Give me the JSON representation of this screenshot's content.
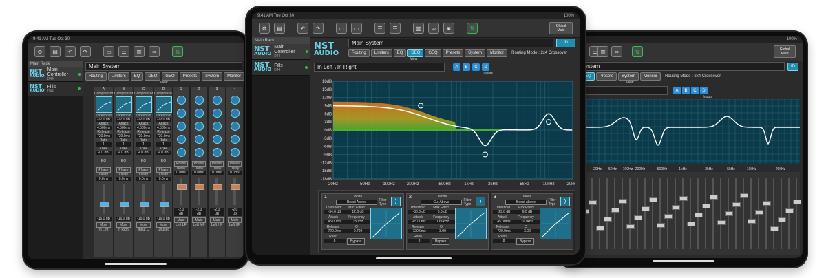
{
  "status": {
    "time": "9:41 AM",
    "date": "Tue Oct 30",
    "battery": "100%"
  },
  "rack": {
    "header": "Main Rack"
  },
  "devices": [
    {
      "logo_top": "NST",
      "logo_bottom": "AUDIO",
      "name": "Main Controller",
      "model": "D44"
    },
    {
      "logo_top": "NST",
      "logo_bottom": "AUDIO",
      "name": "Fills",
      "model": "D44"
    }
  ],
  "system_title": "Main System",
  "tabs": [
    "Routing",
    "Limiters",
    "EQ",
    "DEQ",
    "GEQ",
    "Presets",
    "System",
    "Monitor"
  ],
  "active_tab": "DEQ",
  "view_label": "View",
  "id_button": "ID",
  "routing_mode": "Routing Mode : 2x4 Crossover",
  "global_mute": "Global Mute",
  "channel_input": "In Left \\ In Right",
  "right_channel_input": "Right",
  "inputs_label": "Inputs",
  "input_buttons": [
    "A",
    "B",
    "C",
    "D"
  ],
  "graph": {
    "y_labels": [
      "18dB",
      "15dB",
      "12dB",
      "9dB",
      "6dB",
      "3dB",
      "0dB",
      "-3dB",
      "-6dB",
      "-9dB",
      "-12dB",
      "-15dB",
      "-18dB"
    ],
    "x_labels": [
      "20Hz",
      "50Hz",
      "100Hz",
      "200Hz",
      "500Hz",
      "1kHz",
      "2kHz",
      "5kHz",
      "10kHz",
      "20kHz"
    ],
    "right_x_labels": [
      "20Hz",
      "50Hz",
      "100Hz",
      "200Hz",
      "500Hz",
      "1kHz",
      "2kHz",
      "5kHz",
      "10kHz",
      "20kHz"
    ]
  },
  "dyn_bands": [
    {
      "num": "1",
      "mode_label": "Mode",
      "mode": "Boost Above",
      "filter_type": "Filter Type",
      "threshold_label": "Threshold",
      "threshold": "-34.0 dB",
      "max_effect_label": "Max Effect",
      "max_effect": "12.0 dB",
      "attack_label": "Attack",
      "attack": "45.00ms",
      "frequency_label": "Frequency",
      "frequency": "250Hz",
      "release_label": "Release",
      "release": "720.0ms",
      "q_label": "Q",
      "q": "0.700",
      "ratio_label": "Ratio",
      "ratio": "8",
      "bypass": "Bypass"
    },
    {
      "num": "2",
      "mode_label": "Mode",
      "mode": "Cut Above",
      "filter_type": "Filter Type",
      "threshold_label": "Threshold",
      "threshold": "-30.0 dB",
      "max_effect_label": "Max Effect",
      "max_effect": "6.0 dB",
      "attack_label": "Attack",
      "attack": "45.00ms",
      "frequency_label": "Frequency",
      "frequency": "1.60kHz",
      "release_label": "Release",
      "release": "720.0ms",
      "q_label": "Q",
      "q": "3.00",
      "ratio_label": "Ratio",
      "ratio": "8",
      "bypass": "Bypass"
    },
    {
      "num": "3",
      "mode_label": "Mode",
      "mode": "Boost Above",
      "filter_type": "Filter Type",
      "threshold_label": "Threshold",
      "threshold": "-29.0 dB",
      "max_effect_label": "Max Effect",
      "max_effect": "6.0 dB",
      "attack_label": "Attack",
      "attack": "45.00ms",
      "frequency_label": "Frequency",
      "frequency": "10.0kHz",
      "release_label": "Release",
      "release": "720.0ms",
      "q_label": "Q",
      "q": "3.00",
      "ratio_label": "Ratio",
      "ratio": "8",
      "bypass": "Bypass"
    }
  ],
  "left_strips": {
    "compressor": "Compressor",
    "threshold_label": "Threshold",
    "threshold": "-22.0 dB",
    "attack_label": "Attack",
    "attack": "4.500ms",
    "release_label": "Release",
    "release": "720.0ms",
    "ratio_label": "Ratio",
    "ratio": "1",
    "knee_label": "Knee",
    "knee": "4.0 dB",
    "eq_label": "EQ",
    "phase": "Phase",
    "delay_label": "Delay",
    "delay": "0.0ms",
    "gain": "-16.0 dB",
    "mute": "Mute",
    "names": [
      "In Left",
      "In Right",
      "Input C",
      "Unused"
    ],
    "letters": [
      "A",
      "B",
      "C",
      "D"
    ],
    "out_names": [
      "Left LF",
      "Left MF",
      "Left HF",
      "Left HF",
      "Left LF"
    ],
    "out_numbers": [
      "1",
      "2",
      "3",
      "4",
      "5"
    ],
    "out_gain": "-2.0 dB"
  },
  "colors": {
    "accent": "#1f8fb0",
    "graph_bg": "#0b3a4a",
    "curve": "#ffffff",
    "fill_orange": "#e0701a",
    "fill_green": "#4caf30",
    "led": "#2fbf4f"
  }
}
